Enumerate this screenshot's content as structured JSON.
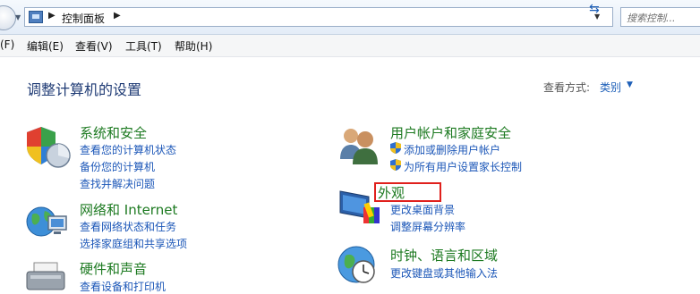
{
  "address_bar": {
    "breadcrumb": "控制面板",
    "search_placeholder": "搜索控制..."
  },
  "menu": {
    "file": "(F)",
    "edit": "编辑(E)",
    "view": "查看(V)",
    "tools": "工具(T)",
    "help": "帮助(H)"
  },
  "header": {
    "title": "调整计算机的设置",
    "view_by_label": "查看方式:",
    "view_by_value": "类别"
  },
  "categories": {
    "system": {
      "title": "系统和安全",
      "links": [
        "查看您的计算机状态",
        "备份您的计算机",
        "查找并解决问题"
      ]
    },
    "network": {
      "title": "网络和 Internet",
      "links": [
        "查看网络状态和任务",
        "选择家庭组和共享选项"
      ]
    },
    "hardware": {
      "title": "硬件和声音",
      "links": [
        "查看设备和打印机"
      ]
    },
    "users": {
      "title": "用户帐户和家庭安全",
      "links": [
        "添加或删除用户帐户",
        "为所有用户设置家长控制"
      ]
    },
    "appearance": {
      "title": "外观",
      "links": [
        "更改桌面背景",
        "调整屏幕分辨率"
      ]
    },
    "clock": {
      "title": "时钟、语言和区域",
      "links": [
        "更改键盘或其他输入法"
      ]
    }
  },
  "colors": {
    "category_title": "#1d7a21",
    "link": "#1c57b8",
    "highlight_box": "#e0201c"
  }
}
